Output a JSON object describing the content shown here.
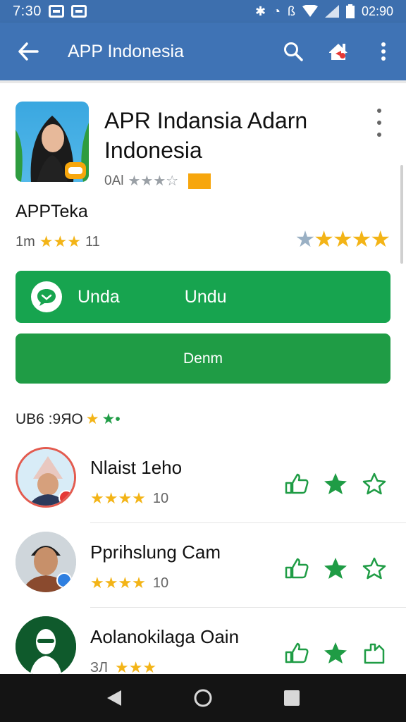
{
  "status_bar": {
    "time": "7:30",
    "clock_right": "02:90",
    "icons": [
      "message-icon",
      "message-icon",
      "bluetooth-icon",
      "alarm-icon",
      "vibrate-icon",
      "wifi-icon",
      "signal-icon",
      "battery-icon"
    ]
  },
  "app_bar": {
    "title": "APP Indonesia",
    "background": "#3f73b5",
    "actions": [
      "search-icon",
      "share-icon",
      "more-vert-icon"
    ]
  },
  "app": {
    "title": "APR Indansia Adarn Indonesia",
    "meta_text": "0Al",
    "meta_stars": "★★★☆",
    "developer": "APPTeka",
    "rating_left_prefix": "1m",
    "rating_left_stars": "★★★",
    "rating_left_count": "11",
    "rating_right_grey": "★",
    "rating_right_gold": "★★★★"
  },
  "buttons": {
    "primary_label_1": "Unda",
    "primary_label_2": "Undu",
    "secondary_label": "Denm",
    "color": "#17a44f"
  },
  "section": {
    "label": "UB6 :9ЯО",
    "stars_gold": "★",
    "stars_green": "★•"
  },
  "reviews": [
    {
      "name": "Nlaist 1eho",
      "stars": "★★★★",
      "count": "10"
    },
    {
      "name": "Pprihslung Cam",
      "stars": "★★★★",
      "count": "10"
    },
    {
      "name": "Aolanokilaga Oain",
      "stars": "★★★",
      "count": "ЗЛ"
    }
  ],
  "nav": [
    "back-icon",
    "home-icon",
    "recents-icon"
  ]
}
